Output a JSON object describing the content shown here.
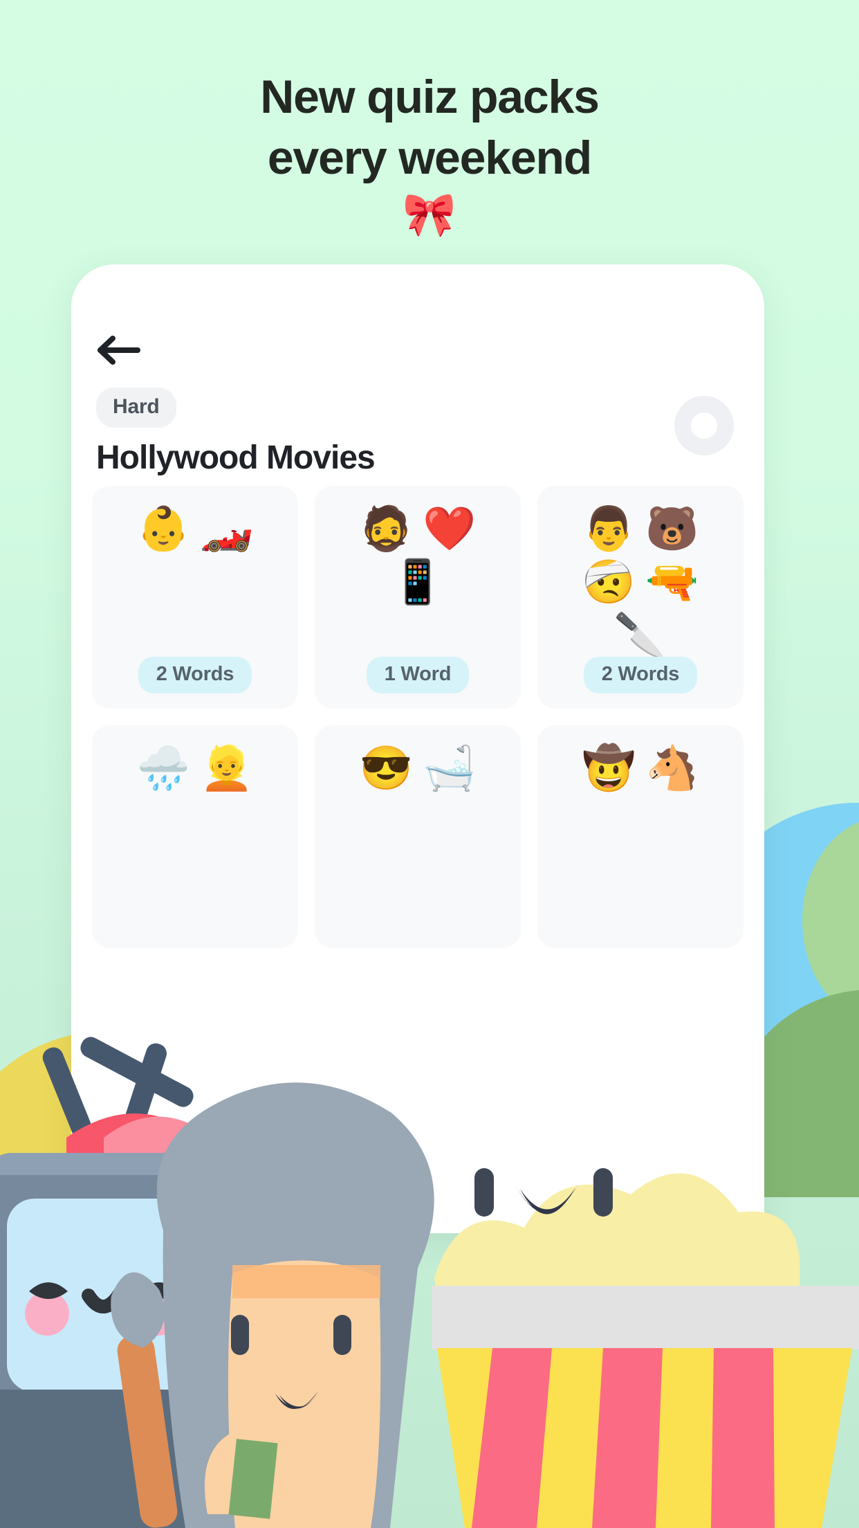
{
  "promo": {
    "headline_line1": "New quiz packs",
    "headline_line2": "every weekend",
    "headline_emoji": "🎀",
    "background_color": "#d2fde3",
    "headline_color": "#232823"
  },
  "phone": {
    "back_icon": "arrow-left-icon",
    "difficulty": "Hard",
    "title": "Hollywood Movies",
    "progress_ring": {
      "value": 0,
      "track_color": "#eef0f3"
    },
    "card_background": "#f8f9fa",
    "pill_color": "#d6f3f9",
    "pill_text_color": "#56636b",
    "cards": [
      {
        "emojis": [
          "👶",
          "🏎️"
        ],
        "emoji_names": [
          "baby-emoji",
          "racing-car-emoji"
        ],
        "word_count_label": "2 Words",
        "layout": "row"
      },
      {
        "emojis": [
          "🧔",
          "❤️",
          "📱"
        ],
        "emoji_names": [
          "bearded-person-emoji",
          "red-heart-emoji",
          "mobile-phone-emoji"
        ],
        "word_count_label": "1 Word",
        "layout": "grid2"
      },
      {
        "emojis": [
          "👨",
          "🐻",
          "🤕",
          "🔫",
          "🔪"
        ],
        "emoji_names": [
          "man-emoji",
          "bear-emoji",
          "head-bandage-emoji",
          "pistol-emoji",
          "kitchen-knife-emoji"
        ],
        "word_count_label": "2 Words",
        "layout": "grid2"
      },
      {
        "emojis": [
          "🌧️",
          "👱"
        ],
        "emoji_names": [
          "rain-cloud-emoji",
          "blond-person-emoji"
        ],
        "word_count_label": "",
        "layout": "row"
      },
      {
        "emojis": [
          "😎",
          "🛁"
        ],
        "emoji_names": [
          "sunglasses-face-emoji",
          "bathtub-emoji"
        ],
        "word_count_label": "",
        "layout": "row"
      },
      {
        "emojis": [
          "🤠",
          "🐴"
        ],
        "emoji_names": [
          "cowboy-hat-face-emoji",
          "horse-face-emoji"
        ],
        "word_count_label": "",
        "layout": "row"
      }
    ]
  },
  "decor": {
    "yellow_circle": "#ecd85a",
    "blue_circle": "#7fd3f4",
    "green_hill": "#84b673",
    "popcorn_yellow": "#f8eea6",
    "popcorn_pink": "#fb6b84",
    "character_hair_gray": "#9aa7b4",
    "character_skin": "#fbd2a4",
    "tv_blue": "#c8e9fa",
    "tv_body": "#7e93a8",
    "clapper_navy": "#46586e",
    "clapper_red": "#f8566a"
  }
}
